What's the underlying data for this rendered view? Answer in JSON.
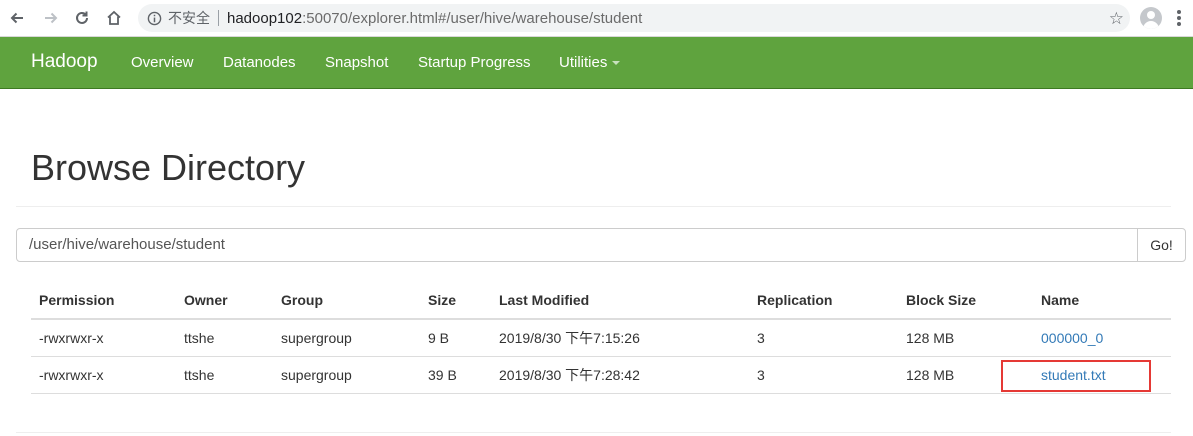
{
  "browser": {
    "security_label": "不安全",
    "url_host": "hadoop102",
    "url_rest": ":50070/explorer.html#/user/hive/warehouse/student"
  },
  "navbar": {
    "brand": "Hadoop",
    "items": [
      "Overview",
      "Datanodes",
      "Snapshot",
      "Startup Progress",
      "Utilities"
    ]
  },
  "page": {
    "title": "Browse Directory",
    "path_value": "/user/hive/warehouse/student",
    "go_label": "Go!"
  },
  "table": {
    "headers": [
      "Permission",
      "Owner",
      "Group",
      "Size",
      "Last Modified",
      "Replication",
      "Block Size",
      "Name"
    ],
    "rows": [
      [
        "-rwxrwxr-x",
        "ttshe",
        "supergroup",
        "9 B",
        "2019/8/30 下午7:15:26",
        "3",
        "128 MB",
        "000000_0"
      ],
      [
        "-rwxrwxr-x",
        "ttshe",
        "supergroup",
        "39 B",
        "2019/8/30 下午7:28:42",
        "3",
        "128 MB",
        "student.txt"
      ]
    ]
  },
  "colors": {
    "navbar": "#5fa33e",
    "link": "#337ab7",
    "highlight": "#e53935"
  }
}
